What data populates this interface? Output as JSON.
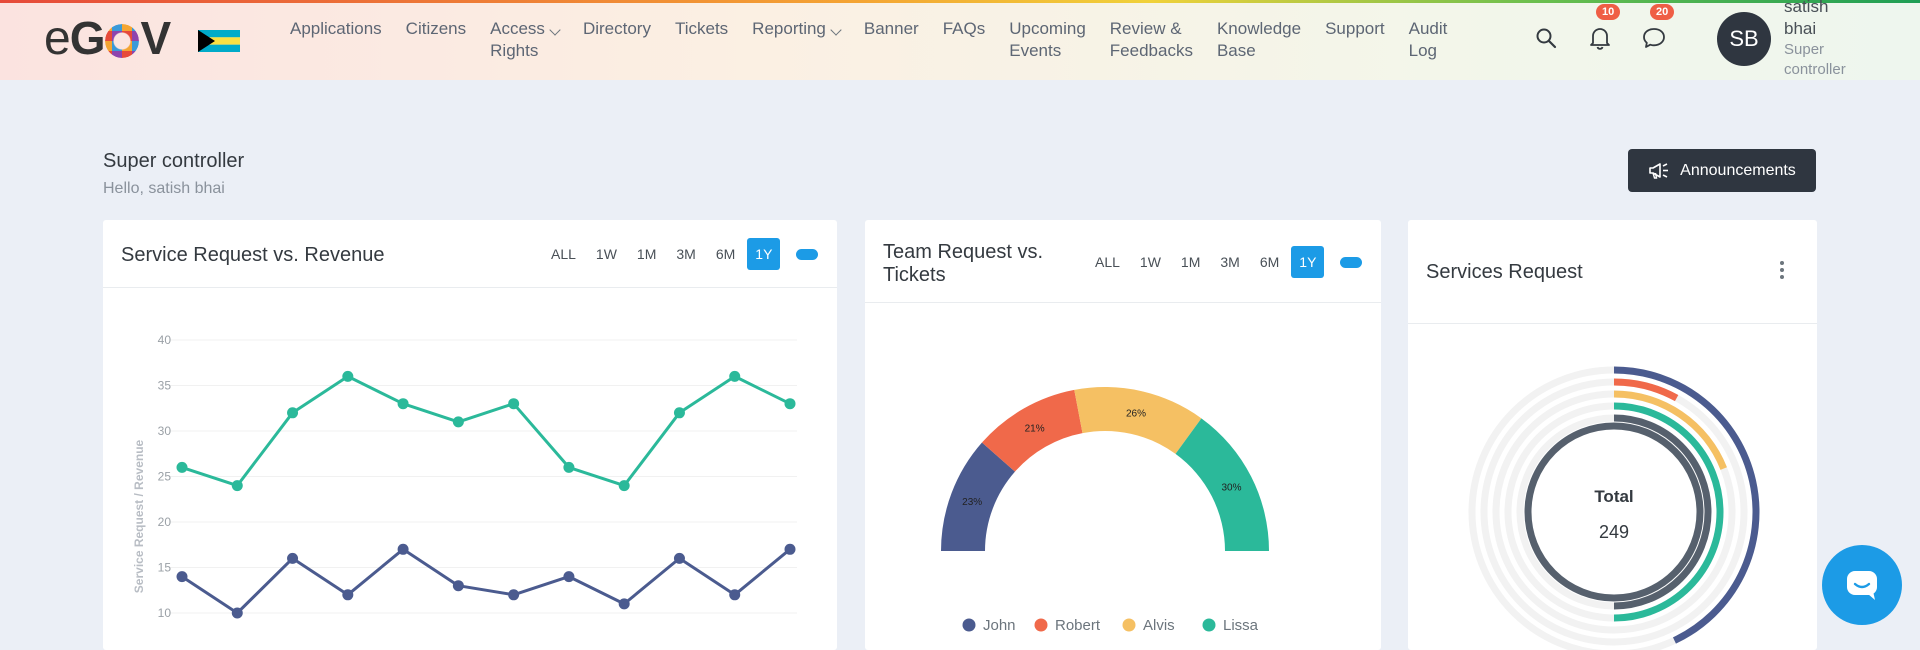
{
  "brand": {
    "logo_parts": [
      "e",
      "G",
      "O",
      "V"
    ]
  },
  "nav": {
    "items": [
      {
        "label": "Applications",
        "dropdown": false
      },
      {
        "label": "Citizens",
        "dropdown": false
      },
      {
        "label": "Access\nRights",
        "dropdown": true
      },
      {
        "label": "Directory",
        "dropdown": false
      },
      {
        "label": "Tickets",
        "dropdown": false
      },
      {
        "label": "Reporting",
        "dropdown": true
      },
      {
        "label": "Banner",
        "dropdown": false
      },
      {
        "label": "FAQs",
        "dropdown": false
      },
      {
        "label": "Upcoming\nEvents",
        "dropdown": false
      },
      {
        "label": "Review &\nFeedbacks",
        "dropdown": false
      },
      {
        "label": "Knowledge\nBase",
        "dropdown": false
      },
      {
        "label": "Support",
        "dropdown": false
      },
      {
        "label": "Audit\nLog",
        "dropdown": false
      }
    ],
    "notifications_count": "10",
    "messages_count": "20",
    "user": {
      "initials": "SB",
      "name": "satish\nbhai",
      "role": "Super\ncontroller"
    }
  },
  "header": {
    "title": "Super controller",
    "greeting": "Hello, satish bhai",
    "announcements_label": "Announcements"
  },
  "range_options": [
    "ALL",
    "1W",
    "1M",
    "3M",
    "6M",
    "1Y"
  ],
  "range_selected": "1Y",
  "cards": {
    "service_vs_revenue": {
      "title": "Service Request vs. Revenue"
    },
    "team_vs_tickets": {
      "title": "Team Request vs.\nTickets"
    },
    "services_request": {
      "title": "Services Request"
    }
  },
  "colors": {
    "accent": "#1c9be6",
    "teal": "#2bb99a",
    "navy": "#4b5b8f",
    "orange": "#f0694a",
    "yellow": "#f5c063",
    "dark": "#2f3640"
  },
  "chart_data": [
    {
      "type": "line",
      "ylabel": "Service Request / Revenue",
      "y_ticks": [
        10,
        15,
        20,
        25,
        30,
        35,
        40
      ],
      "ylim": [
        10,
        40
      ],
      "grid": true,
      "series": [
        {
          "values": [
            26,
            24,
            32,
            36,
            33,
            31,
            33,
            26,
            24,
            32,
            36,
            33
          ]
        },
        {
          "values": [
            14,
            10,
            16,
            12,
            17,
            13,
            12,
            14,
            11,
            16,
            12,
            17
          ]
        }
      ]
    },
    {
      "type": "pie",
      "legend": "bottom",
      "slices": [
        {
          "name": "John",
          "value": 23,
          "label": "23%"
        },
        {
          "name": "Robert",
          "value": 21,
          "label": "21%"
        },
        {
          "name": "Alvis",
          "value": 26,
          "label": "26%"
        },
        {
          "name": "Lissa",
          "value": 30,
          "label": "30%"
        }
      ]
    },
    {
      "type": "radialBar",
      "center_label": "Total",
      "total": "249",
      "bars": [
        {
          "fraction": 0.43
        },
        {
          "fraction": 0.08
        },
        {
          "fraction": 0.19
        },
        {
          "fraction": 0.5
        },
        {
          "fraction": 0.5
        }
      ]
    }
  ]
}
